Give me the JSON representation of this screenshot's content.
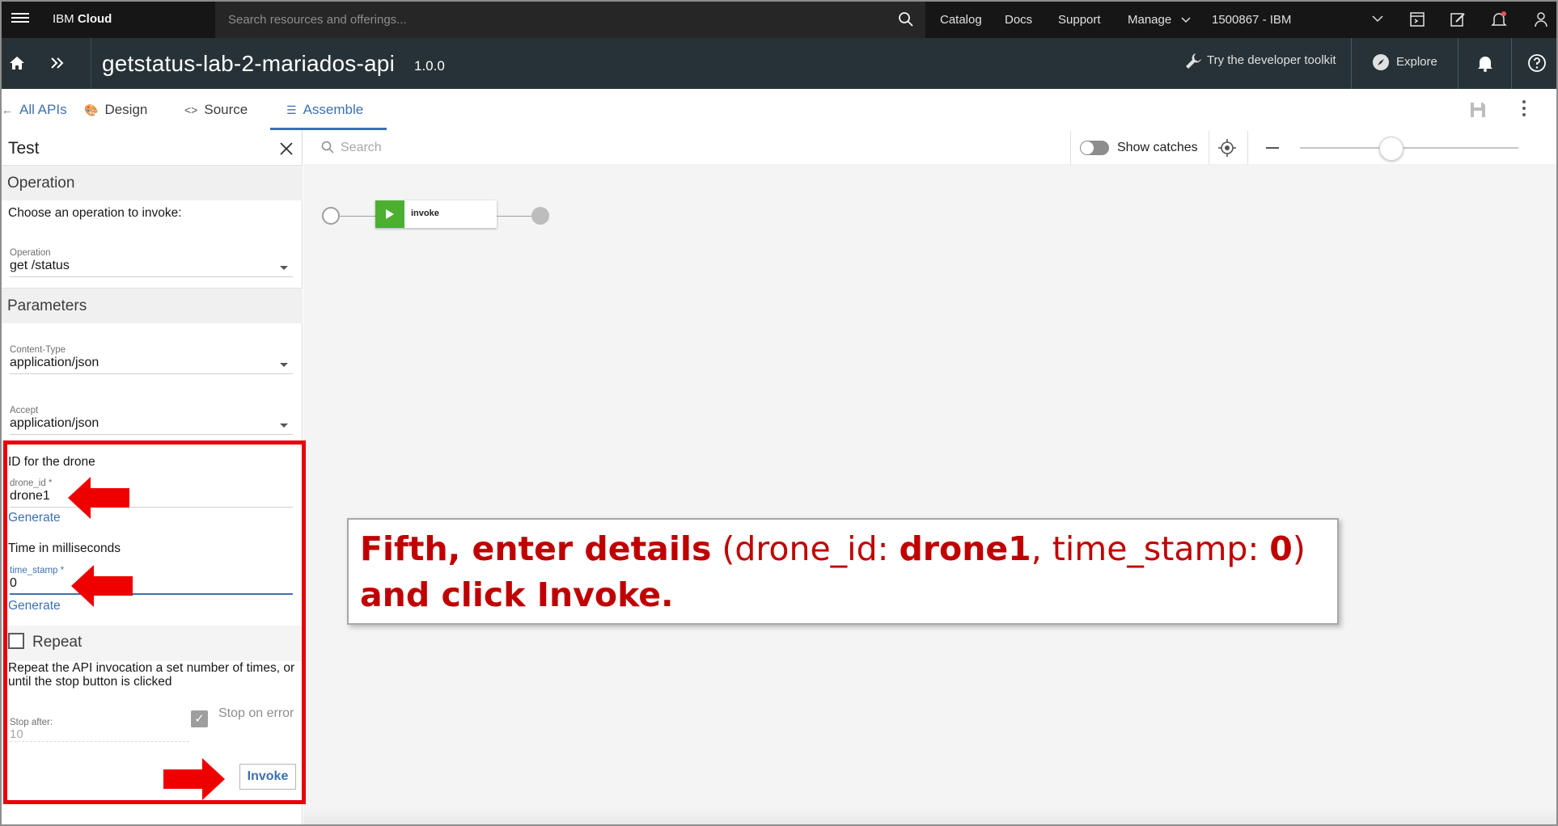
{
  "topbar": {
    "brand_prefix": "IBM",
    "brand_suffix": "Cloud",
    "search_placeholder": "Search resources and offerings...",
    "nav": [
      "Catalog",
      "Docs",
      "Support",
      "Manage"
    ],
    "account": "1500867 - IBM"
  },
  "api": {
    "title": "getstatus-lab-2-mariados-api",
    "version": "1.0.0",
    "toolkit_label": "Try the developer toolkit",
    "explore_label": "Explore"
  },
  "tabs": {
    "all_apis": "All APIs",
    "design": "Design",
    "source": "Source",
    "assemble": "Assemble"
  },
  "test_panel": {
    "title": "Test",
    "operation_heading": "Operation",
    "choose_text": "Choose an operation to invoke:",
    "operation_label": "Operation",
    "operation_value": "get /status",
    "parameters_heading": "Parameters",
    "content_type_label": "Content-Type",
    "content_type_value": "application/json",
    "accept_label": "Accept",
    "accept_value": "application/json",
    "drone_desc": "ID for the drone",
    "drone_label": "drone_id *",
    "drone_value": "drone1",
    "generate_label": "Generate",
    "time_desc": "Time in milliseconds",
    "time_label": "time_stamp *",
    "time_value": "0",
    "repeat_label": "Repeat",
    "repeat_desc": "Repeat the API invocation a set number of times, or until the stop button is clicked",
    "stop_on_error_label": "Stop on error",
    "stop_after_label": "Stop after:",
    "stop_after_value": "10",
    "invoke_label": "Invoke"
  },
  "canvas": {
    "search_placeholder": "Search",
    "show_catches_label": "Show catches",
    "zoom_level": 0.42,
    "node_label": "invoke"
  },
  "callout": {
    "part1": "Fifth, enter details",
    "part2": " (drone_id: ",
    "part3": "drone1",
    "part4": ", time_stamp: ",
    "part5": "0",
    "part6": ")",
    "part7": "and click Invoke."
  },
  "colors": {
    "highlight": "#e8000b",
    "link_blue": "#3d70b2",
    "node_green": "#4caf30",
    "callout_red": "#c00000"
  }
}
